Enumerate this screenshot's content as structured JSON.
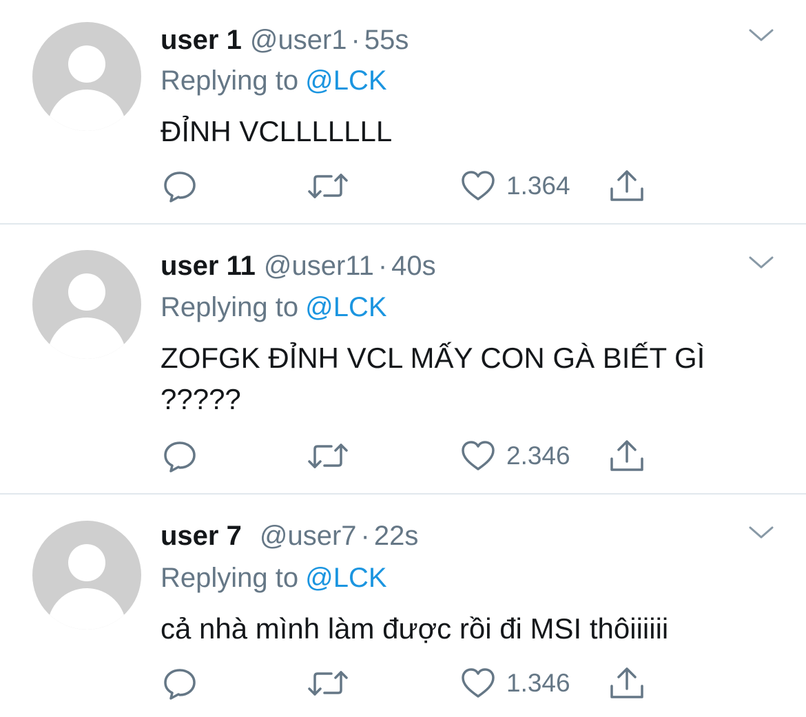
{
  "app": {
    "accent_color": "#1b95e0",
    "secondary_text_color": "#657786"
  },
  "tweets": [
    {
      "name": "user 1",
      "handle": "@user1",
      "separator": "·",
      "time": "55s",
      "reply_prefix": "Replying to",
      "reply_to": "@LCK",
      "text": "ĐỈNH VCLLLLLLL",
      "likes": "1.364",
      "icons": [
        "reply-icon",
        "retweet-icon",
        "like-icon",
        "share-icon",
        "chevron-down-icon"
      ]
    },
    {
      "name": "user 11",
      "handle": "@user11",
      "separator": "·",
      "time": "40s",
      "reply_prefix": "Replying to",
      "reply_to": "@LCK",
      "text": "ZOFGK ĐỈNH VCL MẤY CON GÀ BIẾT GÌ ?????",
      "likes": "2.346",
      "icons": [
        "reply-icon",
        "retweet-icon",
        "like-icon",
        "share-icon",
        "chevron-down-icon"
      ]
    },
    {
      "name": "user 7",
      "handle": "@user7",
      "separator": "·",
      "time": "22s",
      "reply_prefix": "Replying to",
      "reply_to": "@LCK",
      "text": "cả nhà mình làm được rồi đi MSI thôiiiiii",
      "likes": "1.346",
      "icons": [
        "reply-icon",
        "retweet-icon",
        "like-icon",
        "share-icon",
        "chevron-down-icon"
      ]
    }
  ]
}
